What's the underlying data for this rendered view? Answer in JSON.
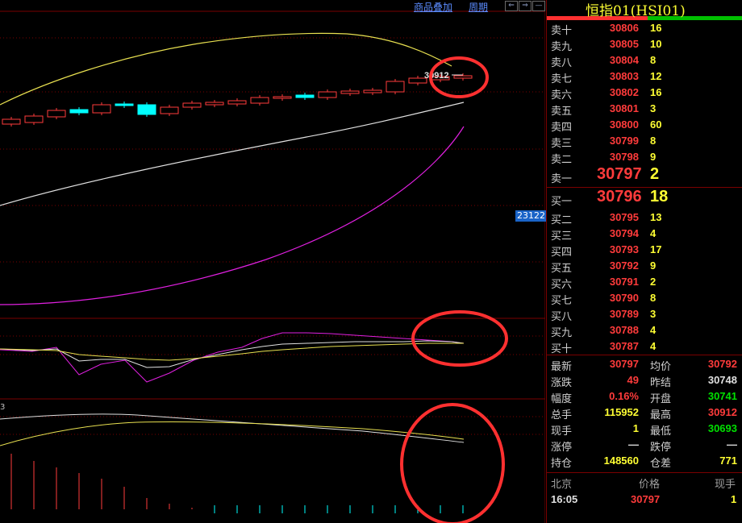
{
  "toolbar": {
    "overlay_label": "商品叠加",
    "period_label": "周期",
    "nav_left": "⇐",
    "nav_right": "⇒",
    "nav_min": "—"
  },
  "chart": {
    "candle_high_label": "30912",
    "price_tag": "23122",
    "volume_axis_label": "3"
  },
  "quote": {
    "title": "恒指01(HSI01)",
    "sell": [
      {
        "label": "卖十",
        "price": "30806",
        "vol": "16"
      },
      {
        "label": "卖九",
        "price": "30805",
        "vol": "10"
      },
      {
        "label": "卖八",
        "price": "30804",
        "vol": "8"
      },
      {
        "label": "卖七",
        "price": "30803",
        "vol": "12"
      },
      {
        "label": "卖六",
        "price": "30802",
        "vol": "16"
      },
      {
        "label": "卖五",
        "price": "30801",
        "vol": "3"
      },
      {
        "label": "卖四",
        "price": "30800",
        "vol": "60"
      },
      {
        "label": "卖三",
        "price": "30799",
        "vol": "8"
      },
      {
        "label": "卖二",
        "price": "30798",
        "vol": "9"
      },
      {
        "label": "卖一",
        "price": "30797",
        "vol": "2"
      }
    ],
    "buy": [
      {
        "label": "买一",
        "price": "30796",
        "vol": "18"
      },
      {
        "label": "买二",
        "price": "30795",
        "vol": "13"
      },
      {
        "label": "买三",
        "price": "30794",
        "vol": "4"
      },
      {
        "label": "买四",
        "price": "30793",
        "vol": "17"
      },
      {
        "label": "买五",
        "price": "30792",
        "vol": "9"
      },
      {
        "label": "买六",
        "price": "30791",
        "vol": "2"
      },
      {
        "label": "买七",
        "price": "30790",
        "vol": "8"
      },
      {
        "label": "买八",
        "price": "30789",
        "vol": "3"
      },
      {
        "label": "买九",
        "price": "30788",
        "vol": "4"
      },
      {
        "label": "买十",
        "price": "30787",
        "vol": "4"
      }
    ],
    "stats": {
      "last_label": "最新",
      "last": "30797",
      "avg_label": "均价",
      "avg": "30792",
      "change_label": "涨跌",
      "change": "49",
      "prev_settle_label": "昨结",
      "prev_settle": "30748",
      "pct_label": "幅度",
      "pct": "0.16%",
      "open_label": "开盘",
      "open": "30741",
      "total_label": "总手",
      "total": "115952",
      "high_label": "最高",
      "high": "30912",
      "cur_label": "现手",
      "cur": "1",
      "low_label": "最低",
      "low": "30693",
      "limit_up_label": "涨停",
      "limit_up": "—",
      "limit_down_label": "跌停",
      "limit_down": "—",
      "oi_label": "持仓",
      "oi": "148560",
      "oi_diff_label": "仓差",
      "oi_diff": "771"
    },
    "ticks": {
      "h_time": "北京",
      "h_price": "价格",
      "h_vol": "现手",
      "time": "16:05",
      "price": "30797",
      "vol": "1"
    }
  },
  "colors": {
    "up": "#ff3b3b",
    "down": "#00ffff",
    "gridline": "#7a0000",
    "ma_yellow": "#e8e050",
    "ma_white": "#e0e0e0",
    "ma_magenta": "#e020e0",
    "annotation": "#ff3030",
    "volume_text": "#ffff33",
    "green": "#00e000"
  }
}
